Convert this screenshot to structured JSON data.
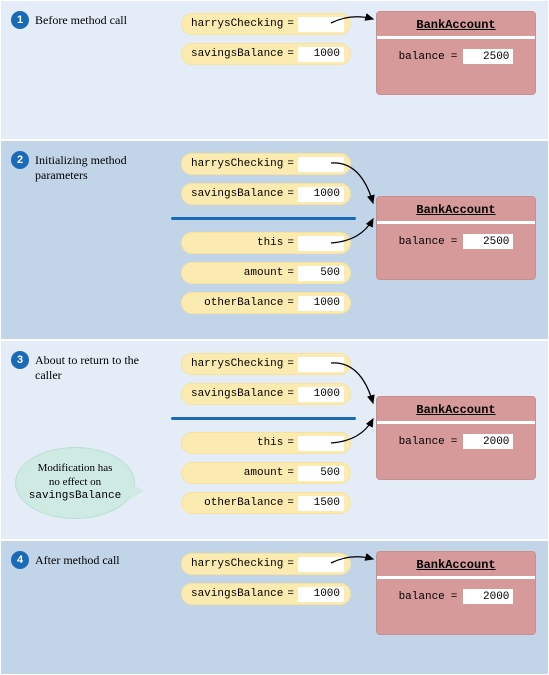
{
  "panels": [
    {
      "num": "1",
      "title": "Before method call",
      "vars_top": [
        {
          "name": "harrysChecking",
          "value": ""
        },
        {
          "name": "savingsBalance",
          "value": "1000"
        }
      ],
      "vars_bottom": [],
      "object": {
        "class": "BankAccount",
        "field": "balance",
        "value": "2500"
      }
    },
    {
      "num": "2",
      "title": "Initializing method parameters",
      "vars_top": [
        {
          "name": "harrysChecking",
          "value": ""
        },
        {
          "name": "savingsBalance",
          "value": "1000"
        }
      ],
      "vars_bottom": [
        {
          "name": "this",
          "value": ""
        },
        {
          "name": "amount",
          "value": "500"
        },
        {
          "name": "otherBalance",
          "value": "1000"
        }
      ],
      "object": {
        "class": "BankAccount",
        "field": "balance",
        "value": "2500"
      }
    },
    {
      "num": "3",
      "title": "About to return to the caller",
      "vars_top": [
        {
          "name": "harrysChecking",
          "value": ""
        },
        {
          "name": "savingsBalance",
          "value": "1000"
        }
      ],
      "vars_bottom": [
        {
          "name": "this",
          "value": ""
        },
        {
          "name": "amount",
          "value": "500"
        },
        {
          "name": "otherBalance",
          "value": "1500"
        }
      ],
      "object": {
        "class": "BankAccount",
        "field": "balance",
        "value": "2000"
      },
      "bubble": {
        "line1": "Modification has",
        "line2": "no effect on",
        "code": "savingsBalance"
      }
    },
    {
      "num": "4",
      "title": "After method call",
      "vars_top": [
        {
          "name": "harrysChecking",
          "value": ""
        },
        {
          "name": "savingsBalance",
          "value": "1000"
        }
      ],
      "vars_bottom": [],
      "object": {
        "class": "BankAccount",
        "field": "balance",
        "value": "2000"
      }
    }
  ]
}
